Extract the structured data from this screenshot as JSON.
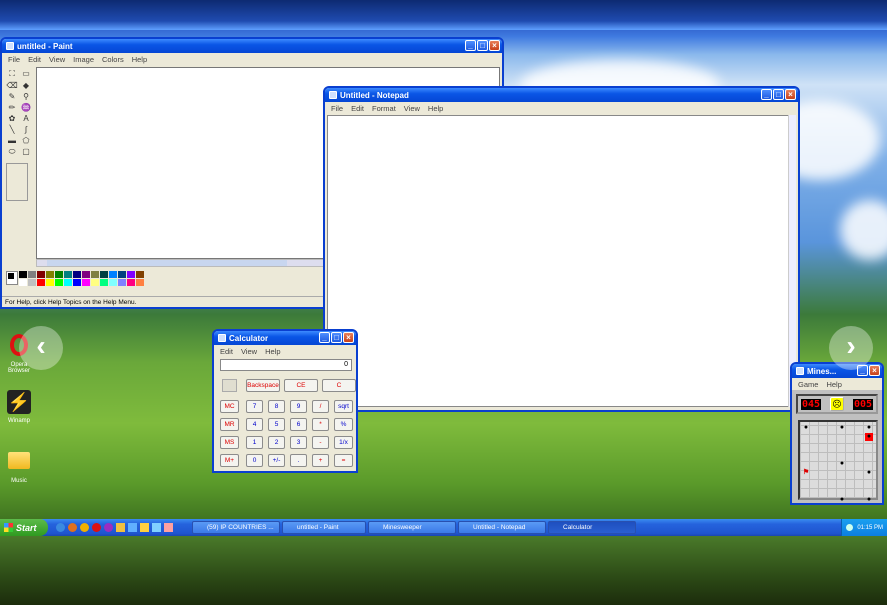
{
  "paint": {
    "title": "untitled - Paint",
    "menu": [
      "File",
      "Edit",
      "View",
      "Image",
      "Colors",
      "Help"
    ],
    "status": "For Help, click Help Topics on the Help Menu."
  },
  "notepad": {
    "title": "Untitled - Notepad",
    "menu": [
      "File",
      "Edit",
      "Format",
      "View",
      "Help"
    ]
  },
  "calculator": {
    "title": "Calculator",
    "menu": [
      "Edit",
      "View",
      "Help"
    ],
    "display": "0",
    "top_buttons": [
      "Backspace",
      "CE",
      "C"
    ],
    "rows": [
      [
        "MC",
        "7",
        "8",
        "9",
        "/",
        "sqrt"
      ],
      [
        "MR",
        "4",
        "5",
        "6",
        "*",
        "%"
      ],
      [
        "MS",
        "1",
        "2",
        "3",
        "-",
        "1/x"
      ],
      [
        "M+",
        "0",
        "+/-",
        ".",
        "+",
        "="
      ]
    ]
  },
  "minesweeper": {
    "title": "Mines...",
    "menu": [
      "Game",
      "Help"
    ],
    "mines_left": "045",
    "timer": "005"
  },
  "desktop": {
    "icons": [
      "Opera Browser",
      "Winamp",
      "Music"
    ]
  },
  "taskbar": {
    "start_label": "Start",
    "tasks": [
      "(59) IP COUNTRIES ...",
      "untitled - Paint",
      "Minesweeper",
      "Untitled - Notepad",
      "Calculator"
    ],
    "clock": "01:15 PM"
  },
  "colors": {
    "accent": "#0a56e6",
    "window_bg": "#ece9d8",
    "taskbar": "#2563dd"
  }
}
